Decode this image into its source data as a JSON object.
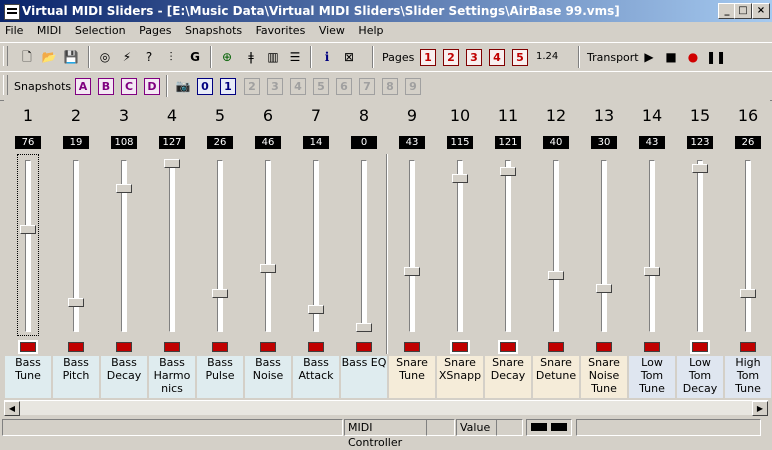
{
  "window": {
    "title": "Virtual MIDI Sliders - [E:\\Music Data\\Virtual MIDI Sliders\\Slider Settings\\AirBase 99.vms]",
    "minimize": "_",
    "maximize": "□",
    "close": "×"
  },
  "menu": [
    "File",
    "MIDI",
    "Selection",
    "Pages",
    "Snapshots",
    "Favorites",
    "View",
    "Help"
  ],
  "toolbar": {
    "g_label": "G",
    "info_label": "i",
    "pages_label": "Pages",
    "pages": [
      "1",
      "2",
      "3",
      "4",
      "5"
    ],
    "version": "1.24",
    "transport_label": "Transport"
  },
  "snapshots": {
    "label": "Snapshots",
    "letters": [
      "A",
      "B",
      "C",
      "D"
    ],
    "numbers": [
      "0",
      "1",
      "2",
      "3",
      "4",
      "5",
      "6",
      "7",
      "8",
      "9"
    ]
  },
  "sliders": [
    {
      "num": "1",
      "value": "76",
      "label": "Bass Tune",
      "level": 76
    },
    {
      "num": "2",
      "value": "19",
      "label": "Bass Pitch",
      "level": 19
    },
    {
      "num": "3",
      "value": "108",
      "label": "Bass Decay",
      "level": 108
    },
    {
      "num": "4",
      "value": "127",
      "label": "Bass Harmo nics",
      "level": 127
    },
    {
      "num": "5",
      "value": "26",
      "label": "Bass Pulse",
      "level": 26
    },
    {
      "num": "6",
      "value": "46",
      "label": "Bass Noise",
      "level": 46
    },
    {
      "num": "7",
      "value": "14",
      "label": "Bass Attack",
      "level": 14
    },
    {
      "num": "8",
      "value": "0",
      "label": "Bass EQ",
      "level": 0
    },
    {
      "num": "9",
      "value": "43",
      "label": "Snare Tune",
      "level": 43
    },
    {
      "num": "10",
      "value": "115",
      "label": "Snare XSnapp",
      "level": 115
    },
    {
      "num": "11",
      "value": "121",
      "label": "Snare Decay",
      "level": 121
    },
    {
      "num": "12",
      "value": "40",
      "label": "Snare Detune",
      "level": 40
    },
    {
      "num": "13",
      "value": "30",
      "label": "Snare Noise Tune",
      "level": 30
    },
    {
      "num": "14",
      "value": "43",
      "label": "Low Tom Tune",
      "level": 43
    },
    {
      "num": "15",
      "value": "123",
      "label": "Low Tom Decay",
      "level": 123
    },
    {
      "num": "16",
      "value": "26",
      "label": "High Tom Tune",
      "level": 26
    }
  ],
  "colors": {
    "bass_bg": "#dfecef",
    "snare_bg": "#f5ecd9",
    "tom_bg": "#dfe6f0"
  },
  "status": {
    "midi_controller": "MIDI Controller",
    "value": "Value"
  }
}
